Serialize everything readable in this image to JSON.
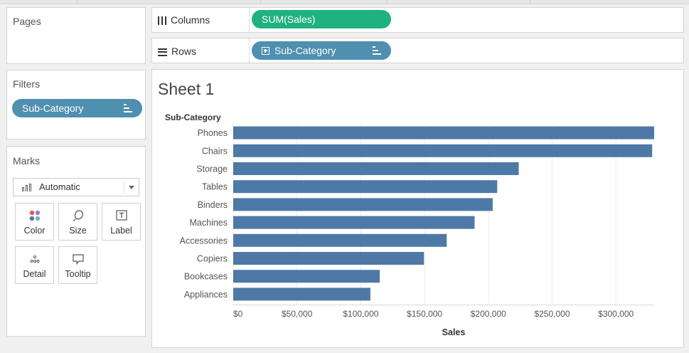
{
  "pages_card": {
    "title": "Pages"
  },
  "filters_card": {
    "title": "Filters",
    "pills": [
      {
        "label": "Sub-Category"
      }
    ]
  },
  "marks_card": {
    "title": "Marks",
    "mark_type": "Automatic",
    "buttons": [
      "Color",
      "Size",
      "Label",
      "Detail",
      "Tooltip"
    ]
  },
  "shelves": {
    "columns": {
      "label": "Columns",
      "pill": "SUM(Sales)"
    },
    "rows": {
      "label": "Rows",
      "pill": "Sub-Category"
    }
  },
  "sheet": {
    "title": "Sheet 1"
  },
  "chart_data": {
    "type": "bar",
    "orientation": "horizontal",
    "y_header": "Sub-Category",
    "categories": [
      "Phones",
      "Chairs",
      "Storage",
      "Tables",
      "Binders",
      "Machines",
      "Accessories",
      "Copiers",
      "Bookcases",
      "Appliances"
    ],
    "values": [
      330007,
      328449,
      223844,
      206966,
      203413,
      189239,
      167380,
      149528,
      114880,
      107532
    ],
    "xlabel": "Sales",
    "x_ticks": [
      0,
      50000,
      100000,
      150000,
      200000,
      250000,
      300000
    ],
    "x_tick_labels": [
      "$0",
      "$50,000",
      "$100,000",
      "$150,000",
      "$200,000",
      "$250,000",
      "$300,000"
    ],
    "xlim": [
      0,
      330000
    ],
    "bar_color": "#4e79a7",
    "grid": true
  },
  "colors": {
    "columns_pill": "#1fb27e",
    "dimension_pill": "#4f8fb0"
  }
}
